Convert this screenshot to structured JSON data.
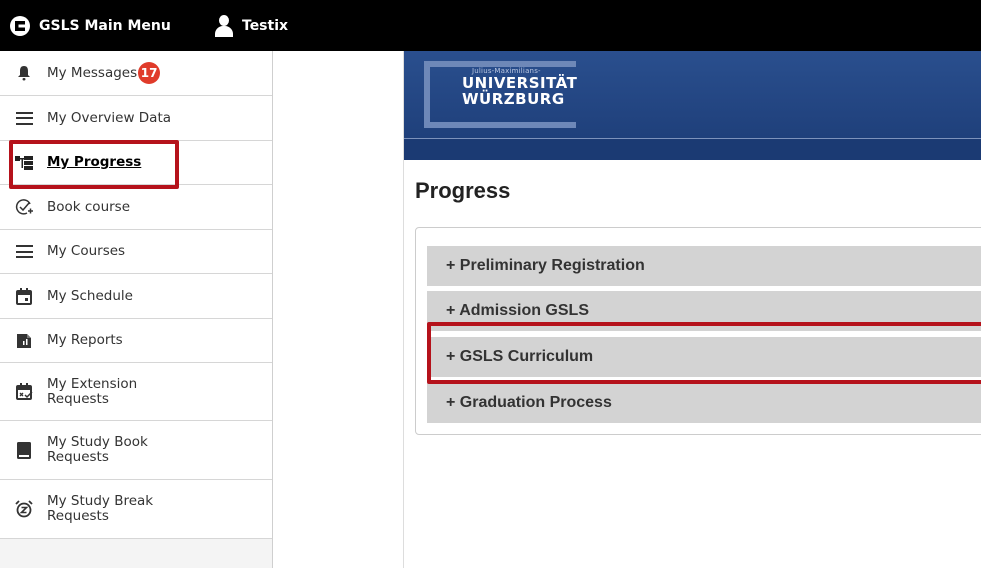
{
  "topbar": {
    "menu_label": "GSLS Main Menu",
    "user_name": "Testix"
  },
  "sidebar": {
    "items": [
      {
        "label": "My Messages",
        "icon": "bell-icon",
        "badge": "17"
      },
      {
        "label": "My Overview Data",
        "icon": "menu-lines-icon"
      },
      {
        "label": "My Progress",
        "icon": "tree-diagram-icon",
        "active": true
      },
      {
        "label": "Book course",
        "icon": "check-add-icon"
      },
      {
        "label": "My Courses",
        "icon": "menu-lines-icon"
      },
      {
        "label": "My Schedule",
        "icon": "calendar-icon"
      },
      {
        "label": "My Reports",
        "icon": "report-icon"
      },
      {
        "label": "My Extension Requests",
        "icon": "calendar-check-icon"
      },
      {
        "label": "My Study Book Requests",
        "icon": "book-icon"
      },
      {
        "label": "My Study Break Requests",
        "icon": "alarm-clock-icon"
      }
    ]
  },
  "banner": {
    "small_text": "Julius-Maximilians-",
    "line1": "UNIVERSITÄT",
    "line2": "WÜRZBURG"
  },
  "main": {
    "title": "Progress",
    "sections": [
      "+ Preliminary Registration",
      "+ Admission GSLS",
      "+ GSLS Curriculum",
      "+ Graduation Process"
    ]
  },
  "colors": {
    "topbar": "#000000",
    "highlight": "#b5121b",
    "badge": "#e03b2a",
    "banner": "#1c3c76",
    "accordion": "#d3d3d3"
  }
}
